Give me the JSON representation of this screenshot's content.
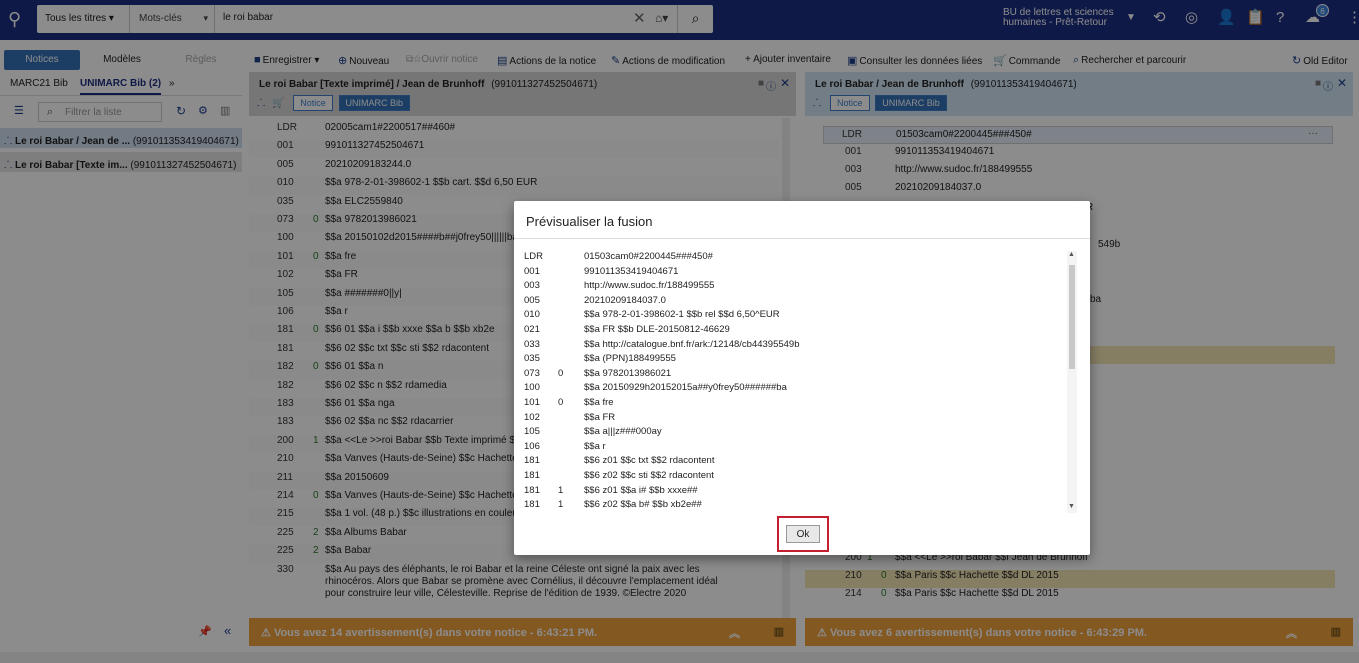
{
  "topbar": {
    "scope": "Tous les titres ▾",
    "search_type": "Mots-clés",
    "search_value": "le roi babar",
    "institution_line1": "BU de lettres et sciences",
    "institution_line2": "humaines - Prêt-Retour",
    "notif_count": "6"
  },
  "toolbar": {
    "tab_notices": "Notices",
    "tab_modeles": "Modèles",
    "tab_regles": "Règles",
    "enregistrer": "Enregistrer",
    "nouveau": "Nouveau",
    "ouvrir": "Ouvrir notice",
    "actions_notice": "Actions de la notice",
    "actions_modif": "Actions de modification",
    "ajouter_inventaire": "Ajouter inventaire",
    "consulter": "Consulter les données liées",
    "commande": "Commande",
    "rechercher": "Rechercher et parcourir",
    "old_editor": "Old Editor"
  },
  "left": {
    "tab_marc21": "MARC21 Bib",
    "tab_unimarc": "UNIMARC Bib (2)",
    "filter_placeholder": "Filtrer la liste",
    "items": [
      {
        "title": "Le roi Babar / Jean de ...",
        "id": "(991011353419404671)"
      },
      {
        "title": "Le roi Babar [Texte im...",
        "id": "(991011327452504671)"
      }
    ]
  },
  "editor_left": {
    "title": "Le roi Babar [Texte imprimé] / Jean de Brunhoff",
    "id": "(991011327452504671)",
    "pill1": "Notice",
    "pill2": "UNIMARC Bib",
    "warning": "Vous avez 14 avertissement(s) dans votre notice - 6:43:21 PM.",
    "rows": [
      {
        "tag": "LDR",
        "ind": "",
        "val": "02005cam1#2200517##460#"
      },
      {
        "tag": "001",
        "ind": "",
        "val": "991011327452504671"
      },
      {
        "tag": "005",
        "ind": "",
        "val": "20210209183244.0"
      },
      {
        "tag": "010",
        "ind": "",
        "val": "$$a 978-2-01-398602-1 $$b cart. $$d 6,50 EUR"
      },
      {
        "tag": "035",
        "ind": "",
        "val": "$$a ELC2559840"
      },
      {
        "tag": "073",
        "ind": "0",
        "val": "$$a 9782013986021"
      },
      {
        "tag": "100",
        "ind": "",
        "val": "$$a 20150102d2015####b##j0frey50||||||ba"
      },
      {
        "tag": "101",
        "ind": "0",
        "val": "$$a fre"
      },
      {
        "tag": "102",
        "ind": "",
        "val": "$$a FR"
      },
      {
        "tag": "105",
        "ind": "",
        "val": "$$a #######0||y|"
      },
      {
        "tag": "106",
        "ind": "",
        "val": "$$a r"
      },
      {
        "tag": "181",
        "ind": "0",
        "val": "$$6 01 $$a i $$b xxxe $$a b $$b xb2e"
      },
      {
        "tag": "181",
        "ind": "",
        "val": "$$6 02 $$c txt $$c sti $$2 rdacontent"
      },
      {
        "tag": "182",
        "ind": "0",
        "val": "$$6 01 $$a n"
      },
      {
        "tag": "182",
        "ind": "",
        "val": "$$6 02 $$c n $$2 rdamedia"
      },
      {
        "tag": "183",
        "ind": "",
        "val": "$$6 01 $$a nga"
      },
      {
        "tag": "183",
        "ind": "",
        "val": "$$6 02 $$a nc $$2 rdacarrier"
      },
      {
        "tag": "200",
        "ind": "1",
        "val": "$$a <<Le >>roi Babar $$b Texte imprimé $$f Jean de Brunhoff"
      },
      {
        "tag": "210",
        "ind": "",
        "val": "$$a Vanves (Hauts-de-Seine) $$c Hachette"
      },
      {
        "tag": "211",
        "ind": "",
        "val": "$$a 20150609"
      },
      {
        "tag": "214",
        "ind": "0",
        "val": "$$a Vanves (Hauts-de-Seine) $$c Hachette"
      },
      {
        "tag": "215",
        "ind": "",
        "val": "$$a 1 vol. (48 p.) $$c illustrations en couleur"
      },
      {
        "tag": "225",
        "ind": "2",
        "val": "$$a Albums Babar"
      },
      {
        "tag": "225",
        "ind": "2",
        "val": "$$a Babar"
      },
      {
        "tag": "330",
        "ind": "",
        "val": "$$a Au pays des éléphants, le roi Babar et la reine Céleste ont signé la paix avec les"
      }
    ],
    "row330_line2": "rhinocéros. Alors que Babar se promène avec Cornélius, il découvre l'emplacement idéal",
    "row330_line3": "pour construire leur ville, Célesteville. Reprise de l'édition de 1939. ©Electre 2020"
  },
  "editor_right": {
    "title": "Le roi Babar / Jean de Brunhoff",
    "id": "(991011353419404671)",
    "pill1": "Notice",
    "pill2": "UNIMARC Bib",
    "warning": "Vous avez 6 avertissement(s) dans votre notice - 6:43:29 PM.",
    "rows": [
      {
        "tag": "LDR",
        "val": "01503cam0#2200445###450#"
      },
      {
        "tag": "001",
        "val": "991011353419404671"
      },
      {
        "tag": "003",
        "val": "http://www.sudoc.fr/188499555"
      },
      {
        "tag": "005",
        "val": "20210209184037.0"
      }
    ],
    "partial_r": "R",
    "partial_549b": "549b",
    "partial_ba": "ba",
    "row200": {
      "tag": "200",
      "ind": "1",
      "val": "$$a <<Le >>roi Babar $$f Jean de Brunhoff"
    },
    "row210": {
      "tag": "210",
      "ind": "0",
      "val": "$$a Paris $$c Hachette $$d DL 2015"
    },
    "row214": {
      "tag": "214",
      "ind": "0",
      "val": "$$a Paris $$c Hachette $$d DL 2015"
    }
  },
  "modal": {
    "title": "Prévisualiser la fusion",
    "ok": "Ok",
    "rows": [
      {
        "tag": "LDR",
        "ind": "",
        "val": "01503cam0#2200445###450#"
      },
      {
        "tag": "001",
        "ind": "",
        "val": "991011353419404671"
      },
      {
        "tag": "003",
        "ind": "",
        "val": "http://www.sudoc.fr/188499555"
      },
      {
        "tag": "005",
        "ind": "",
        "val": "20210209184037.0"
      },
      {
        "tag": "010",
        "ind": "",
        "val": "$$a 978-2-01-398602-1 $$b rel $$d 6,50^EUR"
      },
      {
        "tag": "021",
        "ind": "",
        "val": "$$a FR $$b DLE-20150812-46629"
      },
      {
        "tag": "033",
        "ind": "",
        "val": "$$a http://catalogue.bnf.fr/ark:/12148/cb44395549b"
      },
      {
        "tag": "035",
        "ind": "",
        "val": "$$a (PPN)188499555"
      },
      {
        "tag": "073",
        "ind": "0",
        "val": "$$a 9782013986021"
      },
      {
        "tag": "100",
        "ind": "",
        "val": "$$a 20150929h20152015a##y0frey50######ba"
      },
      {
        "tag": "101",
        "ind": "0",
        "val": "$$a fre"
      },
      {
        "tag": "102",
        "ind": "",
        "val": "$$a FR"
      },
      {
        "tag": "105",
        "ind": "",
        "val": "$$a a|||z###000ay"
      },
      {
        "tag": "106",
        "ind": "",
        "val": "$$a r"
      },
      {
        "tag": "181",
        "ind": "",
        "val": "$$6 z01 $$c txt $$2 rdacontent"
      },
      {
        "tag": "181",
        "ind": "",
        "val": "$$6 z02 $$c sti $$2 rdacontent"
      },
      {
        "tag": "181",
        "ind": "1",
        "val": "$$6 z01 $$a i# $$b xxxe##"
      },
      {
        "tag": "181",
        "ind": "1",
        "val": "$$6 z02 $$a b# $$b xb2e##"
      }
    ]
  },
  "colors": {
    "topbar": "#1c2f82",
    "accent": "#3572b7",
    "warning": "#f0a03d",
    "highlight_frame": "#c31f2f"
  }
}
